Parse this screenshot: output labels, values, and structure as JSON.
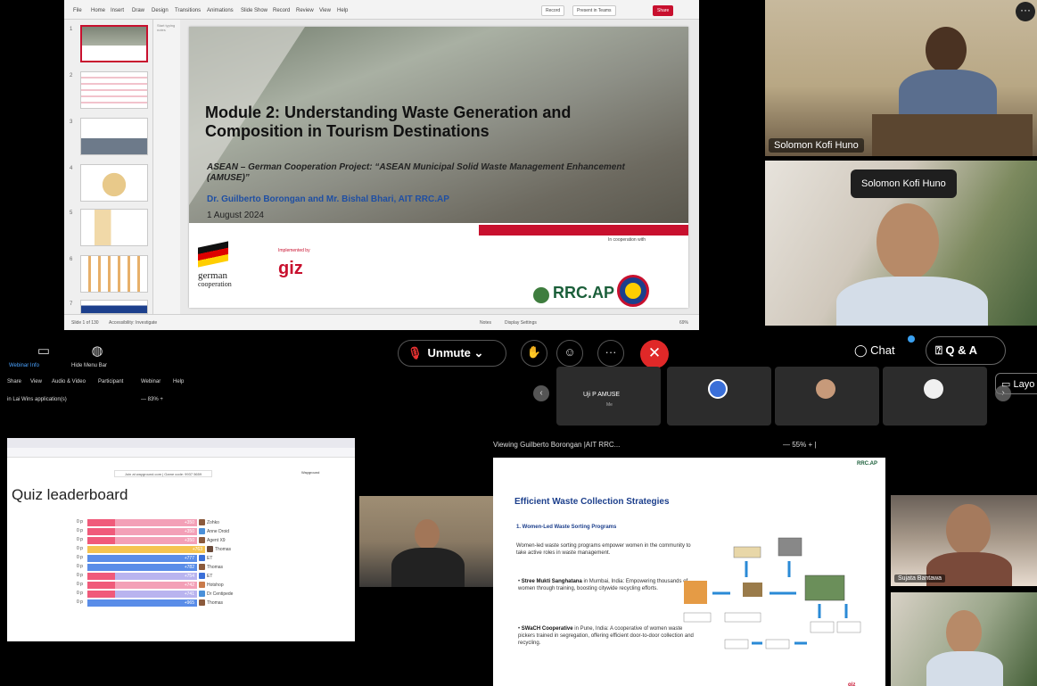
{
  "ppt": {
    "menu": [
      "File",
      "Home",
      "Insert",
      "Draw",
      "Design",
      "Transitions",
      "Animations",
      "Slide Show",
      "Record",
      "Review",
      "View",
      "Help"
    ],
    "record_label": "Record",
    "present_teams_label": "Present in Teams",
    "share_label": "Share",
    "slide_numbers": [
      "1",
      "2",
      "3",
      "4",
      "5",
      "6",
      "7"
    ],
    "notes_hint": "Start typing notes",
    "status_slide": "Slide 1 of 130",
    "status_accessibility": "Accessibility: Investigate",
    "status_notes": "Notes",
    "status_display": "Display Settings",
    "status_zoom": "69%"
  },
  "slide": {
    "title": "Module 2: Understanding Waste Generation and Composition in Tourism Destinations",
    "subtitle": "ASEAN – German Cooperation Project: “ASEAN Municipal Solid Waste Management Enhancement (AMUSE)”",
    "authors": "Dr. Guilberto Borongan and Mr. Bishal Bhari, AIT RRC.AP",
    "date": "1 August 2024",
    "implemented_by": "Implemented by",
    "german_line1": "german",
    "german_line2": "cooperation",
    "giz": "giz",
    "cooperation_with": "In cooperation with",
    "rrcap": "RRC.AP"
  },
  "videos": {
    "solomon_name": "Solomon Kofi Huno",
    "tooltip": "Solomon Kofi Huno",
    "more": "···"
  },
  "toolbar": {
    "unmute": "Unmute",
    "chat": "Chat",
    "qa": "Q & A"
  },
  "webinar2": {
    "info": "Webinar Info",
    "hide_menu": "Hide Menu Bar",
    "menu": [
      "Share",
      "View",
      "Audio & Video",
      "Participant",
      "Webinar",
      "Help"
    ],
    "app_label": "in Lai Wins application(s)",
    "zoom": "— 83% +",
    "participant1_name": "Uji P AMUSE",
    "participant1_sub": "Me",
    "layout": "Layo"
  },
  "quiz": {
    "game_pin_text": "Join at wayground.com | Game code: 9937 5659",
    "brand": "Wayground",
    "title": "Quiz leaderboard",
    "rows": [
      {
        "score": "0 p",
        "value": "+350",
        "name": "Zohko",
        "bar": "#f3a0b7",
        "frac": 0.41
      },
      {
        "score": "0 p",
        "value": "+350",
        "name": "Anne Droid",
        "bar": "#f3a0b7",
        "frac": 0.41
      },
      {
        "score": "0 p",
        "value": "+350",
        "name": "Agent X9",
        "bar": "#f3a0b7",
        "frac": 0.41
      },
      {
        "score": "0 p",
        "value": "+763",
        "name": "Thomas",
        "bar": "#f5c451",
        "frac": 0.44
      },
      {
        "score": "0 p",
        "value": "+777",
        "name": "ET",
        "bar": "#5a8de8",
        "frac": 0.41
      },
      {
        "score": "0 p",
        "value": "+782",
        "name": "Thomas",
        "bar": "#5a8de8",
        "frac": 0.41
      },
      {
        "score": "0 p",
        "value": "+754",
        "name": "ET",
        "bar": "#b9b4ef",
        "frac": 0.41
      },
      {
        "score": "0 p",
        "value": "+742",
        "name": "Hotshop",
        "bar": "#f3a0b7",
        "frac": 0.41
      },
      {
        "score": "0 p",
        "value": "+741",
        "name": "Dr Centipede",
        "bar": "#b9b4ef",
        "frac": 0.41
      },
      {
        "score": "0 p",
        "value": "+965",
        "name": "Thomas",
        "bar": "#5a8de8",
        "frac": 0.41
      }
    ]
  },
  "slide2": {
    "viewing": "Viewing Guilberto Borongan |AIT RRC...",
    "zoom": "— 55% + |",
    "title": "Efficient Waste Collection Strategies",
    "heading": "1. Women-Led Waste Sorting Programs",
    "intro": "Women-led waste sorting programs empower women in the community to take active roles in waste management.",
    "b1_bold": "Stree Mukti Sanghatana",
    "b1_rest": " in Mumbai, India: Empowering thousands of women through training, boosting citywide recycling efforts.",
    "b2_bold": "SWaCH Cooperative",
    "b2_rest": " in Pune, India: A cooperative of women waste pickers trained in segregation, offering efficient door-to-door collection and recycling.",
    "footer": "giz",
    "rrcap_small": "RRC.AP"
  },
  "small_videos": {
    "sujata": "Sujata Bantawa"
  }
}
